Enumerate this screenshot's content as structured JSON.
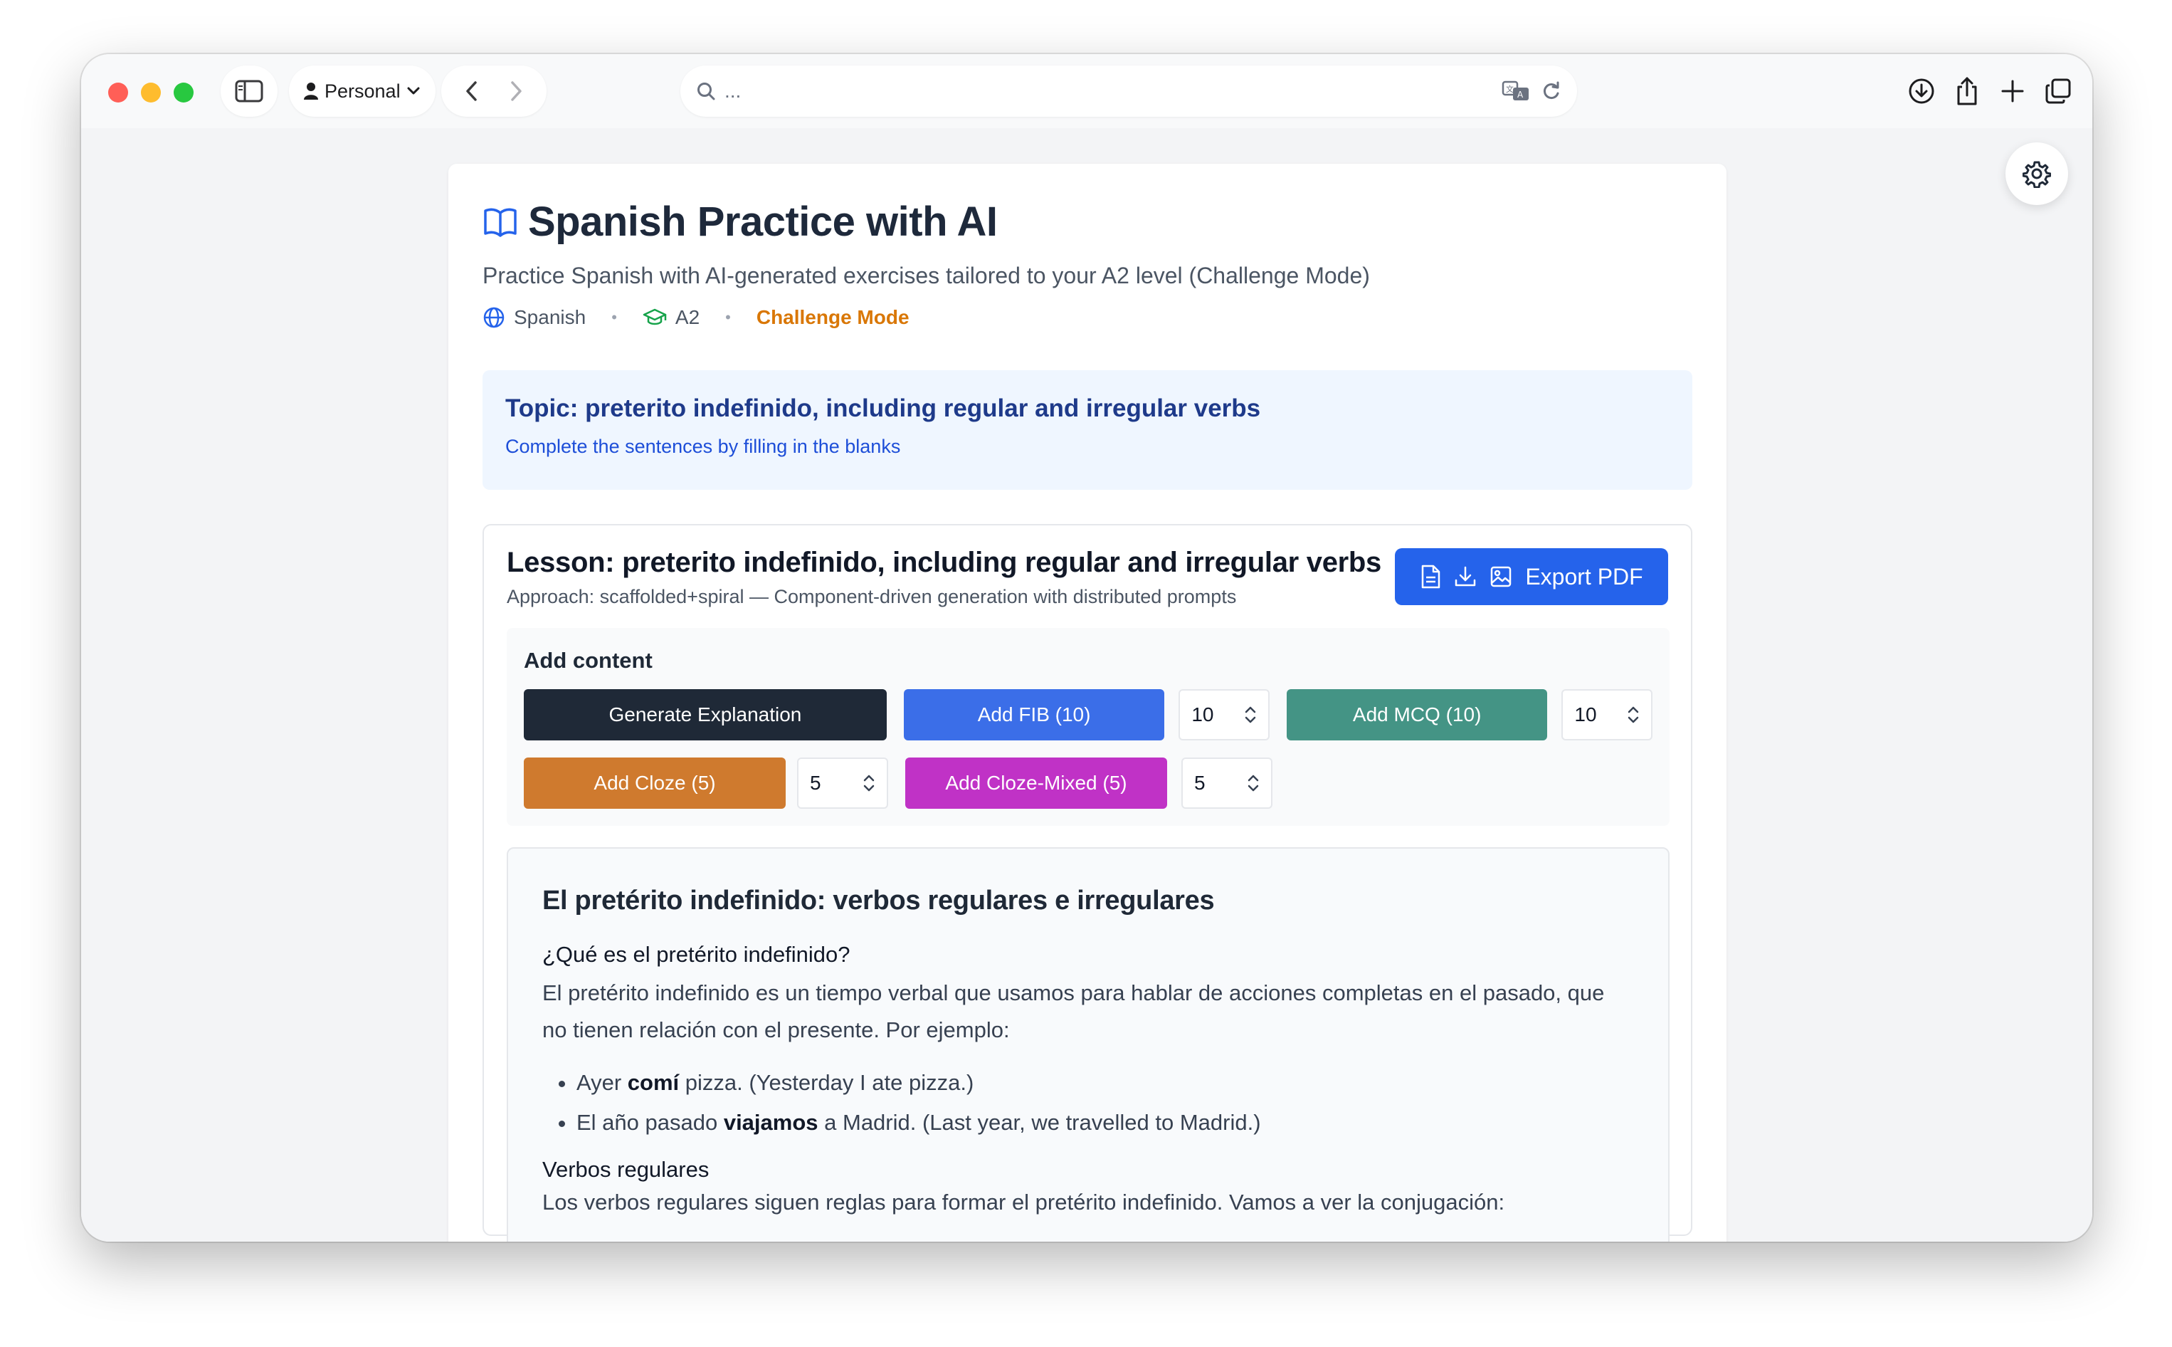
{
  "browser": {
    "profile_label": "Personal",
    "address_text": "..."
  },
  "page": {
    "title": "Spanish Practice with AI",
    "subtitle": "Practice Spanish with AI-generated exercises tailored to your A2 level (Challenge Mode)",
    "meta": {
      "language": "Spanish",
      "level": "A2",
      "mode": "Challenge Mode"
    }
  },
  "topic": {
    "title": "Topic: preterito indefinido, including regular and irregular verbs",
    "instruction": "Complete the sentences by filling in the blanks"
  },
  "lesson": {
    "title": "Lesson: preterito indefinido, including regular and irregular verbs",
    "approach": "Approach: scaffolded+spiral — Component-driven generation with distributed prompts",
    "export_label": "Export PDF"
  },
  "add_content": {
    "title": "Add content",
    "generate_explanation": "Generate Explanation",
    "add_fib": "Add FIB (10)",
    "fib_count": "10",
    "add_mcq": "Add MCQ (10)",
    "mcq_count": "10",
    "add_cloze": "Add Cloze (5)",
    "cloze_count": "5",
    "add_cloze_mixed": "Add Cloze-Mixed (5)",
    "cloze_mixed_count": "5"
  },
  "explanation": {
    "heading": "El pretérito indefinido: verbos regulares e irregulares",
    "q1": "¿Qué es el pretérito indefinido?",
    "para1": "El pretérito indefinido es un tiempo verbal que usamos para hablar de acciones completas en el pasado, que no tienen relación con el presente. Por ejemplo:",
    "examples": [
      {
        "pre": "Ayer ",
        "bold": "comí",
        "post": " pizza. (Yesterday I ate pizza.)"
      },
      {
        "pre": "El año pasado ",
        "bold": "viajamos",
        "post": " a Madrid. (Last year, we travelled to Madrid.)"
      }
    ],
    "q2": "Verbos regulares",
    "para2_partial": "Los verbos regulares siguen reglas para formar el pretérito indefinido. Vamos a ver la conjugación:"
  },
  "colors": {
    "primary_blue": "#2563eb",
    "dark": "#1f2937",
    "teal": "#449485",
    "orange": "#cf7a2e",
    "purple": "#c032c6",
    "challenge": "#d97706"
  }
}
